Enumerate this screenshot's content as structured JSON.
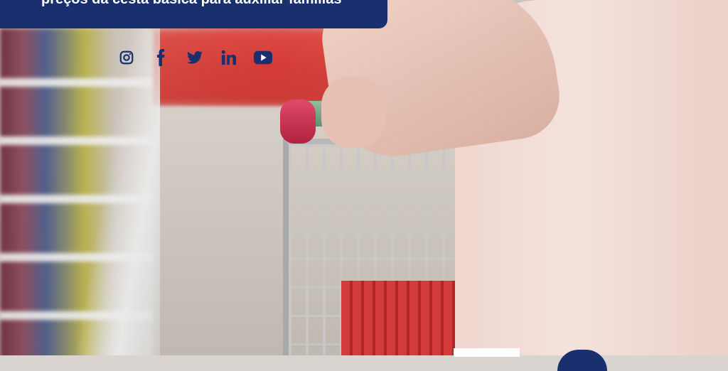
{
  "banner": {
    "headline": "preços da cesta básica para auxiliar famílias",
    "background_color": "#1a2f6e"
  },
  "social": {
    "icons": [
      "instagram-icon",
      "facebook-icon",
      "twitter-icon",
      "linkedin-icon",
      "youtube-icon"
    ],
    "color": "#1a2f6e"
  }
}
